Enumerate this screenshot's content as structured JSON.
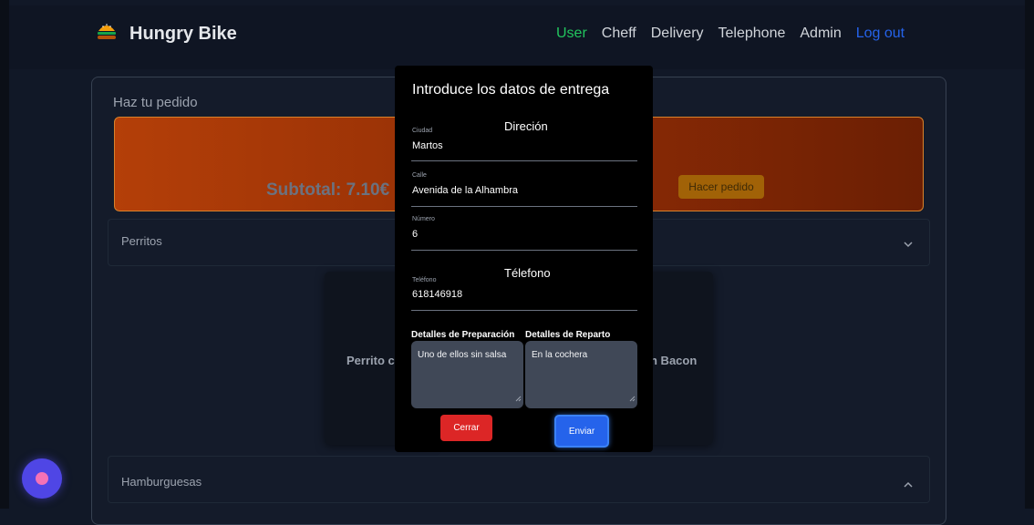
{
  "navbar": {
    "brand": "Hungry Bike",
    "links": [
      "User",
      "Cheff",
      "Delivery",
      "Telephone",
      "Admin"
    ],
    "logout": "Log out"
  },
  "order": {
    "title": "Haz tu pedido",
    "subtotal": "Subtotal: 7.10€",
    "button": "Hacer pedido"
  },
  "categories": [
    "Perritos",
    "Hamburguesas"
  ],
  "products": [
    "Perrito co",
    "n Bacon"
  ],
  "modal": {
    "title": "Introduce los datos de entrega",
    "address_section": "Direción",
    "fields": [
      {
        "label": "Ciudad",
        "value": "Martos"
      },
      {
        "label": "Calle",
        "value": "Avenida de la Alhambra"
      },
      {
        "label": "Número",
        "value": "6"
      }
    ],
    "phone_section": "Télefono",
    "phone": {
      "label": "Teléfono",
      "value": "618146918"
    },
    "prep": {
      "label": "Detalles de Preparación",
      "value": "Uno de ellos sin salsa"
    },
    "delivery": {
      "label": "Detalles de Reparto",
      "value": "En la cochera"
    },
    "close_button": "Cerrar",
    "send_button": "Enviar"
  },
  "icons": {
    "brand": "burger-bike-icon",
    "chevron_down": "chevron-down-icon",
    "chevron_up": "chevron-up-icon",
    "chat": "chat-bubble-icon"
  },
  "colors": {
    "accent_active": "#22c55e",
    "logout": "#2563eb",
    "order_panel": "#b43f08",
    "close": "#dc2626",
    "send": "#2563eb"
  }
}
